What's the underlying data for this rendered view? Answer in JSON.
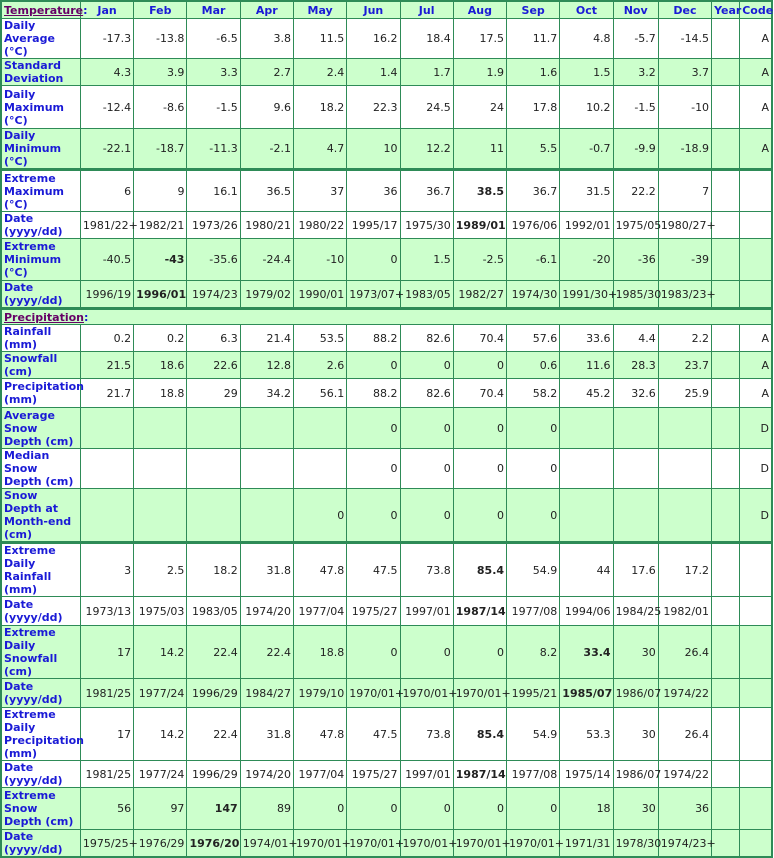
{
  "header": {
    "section_temperature": "Temperature",
    "colon": ":",
    "months": [
      "Jan",
      "Feb",
      "Mar",
      "Apr",
      "May",
      "Jun",
      "Jul",
      "Aug",
      "Sep",
      "Oct",
      "Nov",
      "Dec"
    ],
    "year": "Year",
    "code": "Code"
  },
  "colors": {
    "border": "#2e8b57",
    "green_row": "#ccffcc",
    "label_text": "#1a1ad6",
    "section_link": "#660066"
  },
  "temperature_rows": [
    {
      "label": "Daily Average (°C)",
      "style": "white",
      "values": [
        "-17.3",
        "-13.8",
        "-6.5",
        "3.8",
        "11.5",
        "16.2",
        "18.4",
        "17.5",
        "11.7",
        "4.8",
        "-5.7",
        "-14.5"
      ],
      "year": "",
      "code": "A",
      "bold": []
    },
    {
      "label": "Standard Deviation",
      "style": "green",
      "values": [
        "4.3",
        "3.9",
        "3.3",
        "2.7",
        "2.4",
        "1.4",
        "1.7",
        "1.9",
        "1.6",
        "1.5",
        "3.2",
        "3.7"
      ],
      "year": "",
      "code": "A",
      "bold": []
    },
    {
      "label": "Daily Maximum (°C)",
      "style": "white",
      "values": [
        "-12.4",
        "-8.6",
        "-1.5",
        "9.6",
        "18.2",
        "22.3",
        "24.5",
        "24",
        "17.8",
        "10.2",
        "-1.5",
        "-10"
      ],
      "year": "",
      "code": "A",
      "bold": []
    },
    {
      "label": "Daily Minimum (°C)",
      "style": "green",
      "values": [
        "-22.1",
        "-18.7",
        "-11.3",
        "-2.1",
        "4.7",
        "10",
        "12.2",
        "11",
        "5.5",
        "-0.7",
        "-9.9",
        "-18.9"
      ],
      "year": "",
      "code": "A",
      "bold": []
    },
    {
      "label": "Extreme Maximum (°C)",
      "style": "white",
      "section_start": true,
      "values": [
        "6",
        "9",
        "16.1",
        "36.5",
        "37",
        "36",
        "36.7",
        "38.5",
        "36.7",
        "31.5",
        "22.2",
        "7"
      ],
      "year": "",
      "code": "",
      "bold": [
        7
      ]
    },
    {
      "label": "Date (yyyy/dd)",
      "style": "white",
      "values": [
        "1981/22+",
        "1982/21",
        "1973/26",
        "1980/21",
        "1980/22",
        "1995/17",
        "1975/30",
        "1989/01",
        "1976/06",
        "1992/01",
        "1975/05",
        "1980/27+"
      ],
      "year": "",
      "code": "",
      "bold": [
        7
      ]
    },
    {
      "label": "Extreme Minimum (°C)",
      "style": "green",
      "values": [
        "-40.5",
        "-43",
        "-35.6",
        "-24.4",
        "-10",
        "0",
        "1.5",
        "-2.5",
        "-6.1",
        "-20",
        "-36",
        "-39"
      ],
      "year": "",
      "code": "",
      "bold": [
        1
      ]
    },
    {
      "label": "Date (yyyy/dd)",
      "style": "green",
      "values": [
        "1996/19",
        "1996/01",
        "1974/23",
        "1979/02",
        "1990/01",
        "1973/07+",
        "1983/05",
        "1982/27",
        "1974/30",
        "1991/30+",
        "1985/30",
        "1983/23+"
      ],
      "year": "",
      "code": "",
      "bold": [
        1
      ]
    }
  ],
  "section_precipitation": "Precipitation",
  "precipitation_rows": [
    {
      "label": "Rainfall (mm)",
      "style": "white",
      "values": [
        "0.2",
        "0.2",
        "6.3",
        "21.4",
        "53.5",
        "88.2",
        "82.6",
        "70.4",
        "57.6",
        "33.6",
        "4.4",
        "2.2"
      ],
      "year": "",
      "code": "A",
      "bold": []
    },
    {
      "label": "Snowfall (cm)",
      "style": "green",
      "values": [
        "21.5",
        "18.6",
        "22.6",
        "12.8",
        "2.6",
        "0",
        "0",
        "0",
        "0.6",
        "11.6",
        "28.3",
        "23.7"
      ],
      "year": "",
      "code": "A",
      "bold": []
    },
    {
      "label": "Precipitation (mm)",
      "style": "white",
      "values": [
        "21.7",
        "18.8",
        "29",
        "34.2",
        "56.1",
        "88.2",
        "82.6",
        "70.4",
        "58.2",
        "45.2",
        "32.6",
        "25.9"
      ],
      "year": "",
      "code": "A",
      "bold": []
    },
    {
      "label": "Average Snow Depth (cm)",
      "style": "green",
      "values": [
        "",
        "",
        "",
        "",
        "",
        "0",
        "0",
        "0",
        "0",
        "",
        "",
        ""
      ],
      "year": "",
      "code": "D",
      "bold": []
    },
    {
      "label": "Median Snow Depth (cm)",
      "style": "white",
      "values": [
        "",
        "",
        "",
        "",
        "",
        "0",
        "0",
        "0",
        "0",
        "",
        "",
        ""
      ],
      "year": "",
      "code": "D",
      "bold": []
    },
    {
      "label": "Snow Depth at Month-end (cm)",
      "style": "green",
      "values": [
        "",
        "",
        "",
        "",
        "0",
        "0",
        "0",
        "0",
        "0",
        "",
        "",
        ""
      ],
      "year": "",
      "code": "D",
      "bold": []
    },
    {
      "label": "Extreme Daily Rainfall (mm)",
      "style": "white",
      "section_start": true,
      "values": [
        "3",
        "2.5",
        "18.2",
        "31.8",
        "47.8",
        "47.5",
        "73.8",
        "85.4",
        "54.9",
        "44",
        "17.6",
        "17.2"
      ],
      "year": "",
      "code": "",
      "bold": [
        7
      ]
    },
    {
      "label": "Date (yyyy/dd)",
      "style": "white",
      "values": [
        "1973/13",
        "1975/03",
        "1983/05",
        "1974/20",
        "1977/04",
        "1975/27",
        "1997/01",
        "1987/14",
        "1977/08",
        "1994/06",
        "1984/25",
        "1982/01"
      ],
      "year": "",
      "code": "",
      "bold": [
        7
      ]
    },
    {
      "label": "Extreme Daily Snowfall (cm)",
      "style": "green",
      "values": [
        "17",
        "14.2",
        "22.4",
        "22.4",
        "18.8",
        "0",
        "0",
        "0",
        "8.2",
        "33.4",
        "30",
        "26.4"
      ],
      "year": "",
      "code": "",
      "bold": [
        9
      ]
    },
    {
      "label": "Date (yyyy/dd)",
      "style": "green",
      "values": [
        "1981/25",
        "1977/24",
        "1996/29",
        "1984/27",
        "1979/10",
        "1970/01+",
        "1970/01+",
        "1970/01+",
        "1995/21",
        "1985/07",
        "1986/07",
        "1974/22"
      ],
      "year": "",
      "code": "",
      "bold": [
        9
      ]
    },
    {
      "label": "Extreme Daily Precipitation (mm)",
      "style": "white",
      "values": [
        "17",
        "14.2",
        "22.4",
        "31.8",
        "47.8",
        "47.5",
        "73.8",
        "85.4",
        "54.9",
        "53.3",
        "30",
        "26.4"
      ],
      "year": "",
      "code": "",
      "bold": [
        7
      ]
    },
    {
      "label": "Date (yyyy/dd)",
      "style": "white",
      "values": [
        "1981/25",
        "1977/24",
        "1996/29",
        "1974/20",
        "1977/04",
        "1975/27",
        "1997/01",
        "1987/14",
        "1977/08",
        "1975/14",
        "1986/07",
        "1974/22"
      ],
      "year": "",
      "code": "",
      "bold": [
        7
      ]
    },
    {
      "label": "Extreme Snow Depth (cm)",
      "style": "green",
      "values": [
        "56",
        "97",
        "147",
        "89",
        "0",
        "0",
        "0",
        "0",
        "0",
        "18",
        "30",
        "36"
      ],
      "year": "",
      "code": "",
      "bold": [
        2
      ]
    },
    {
      "label": "Date (yyyy/dd)",
      "style": "green",
      "values": [
        "1975/25+",
        "1976/29",
        "1976/20",
        "1974/01+",
        "1970/01+",
        "1970/01+",
        "1970/01+",
        "1970/01+",
        "1970/01+",
        "1971/31",
        "1978/30",
        "1974/23+"
      ],
      "year": "",
      "code": "",
      "bold": [
        2
      ]
    }
  ]
}
